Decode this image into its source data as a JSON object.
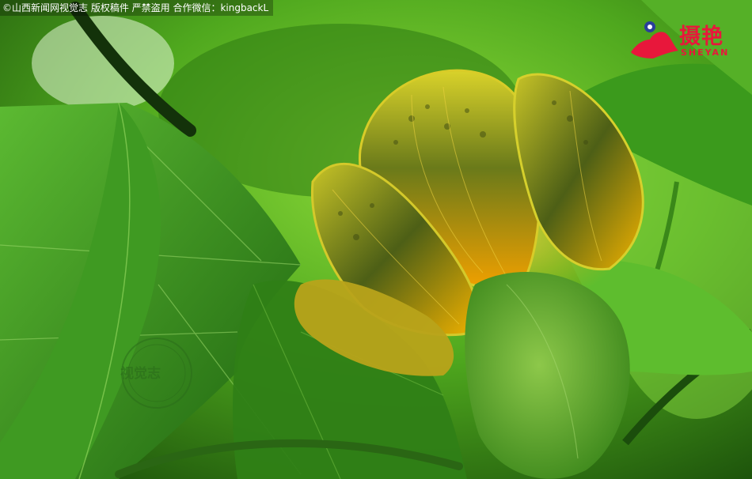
{
  "copyright_bar": {
    "symbol": "©",
    "text": "山西新闻网视觉志  版权稿件  严禁盗用  合作微信：kingbackL"
  },
  "brand": {
    "main": "摄艳",
    "sub": "SHEYAN",
    "color": "#e8173b"
  },
  "watermark": {
    "main": "视觉志",
    "color": "#2b6d1a"
  },
  "palette": {
    "leaf_light": "#7fd14a",
    "leaf_dark": "#1f5a0c",
    "petal_yellow": "#e0c400",
    "petal_orange": "#f0a500"
  }
}
